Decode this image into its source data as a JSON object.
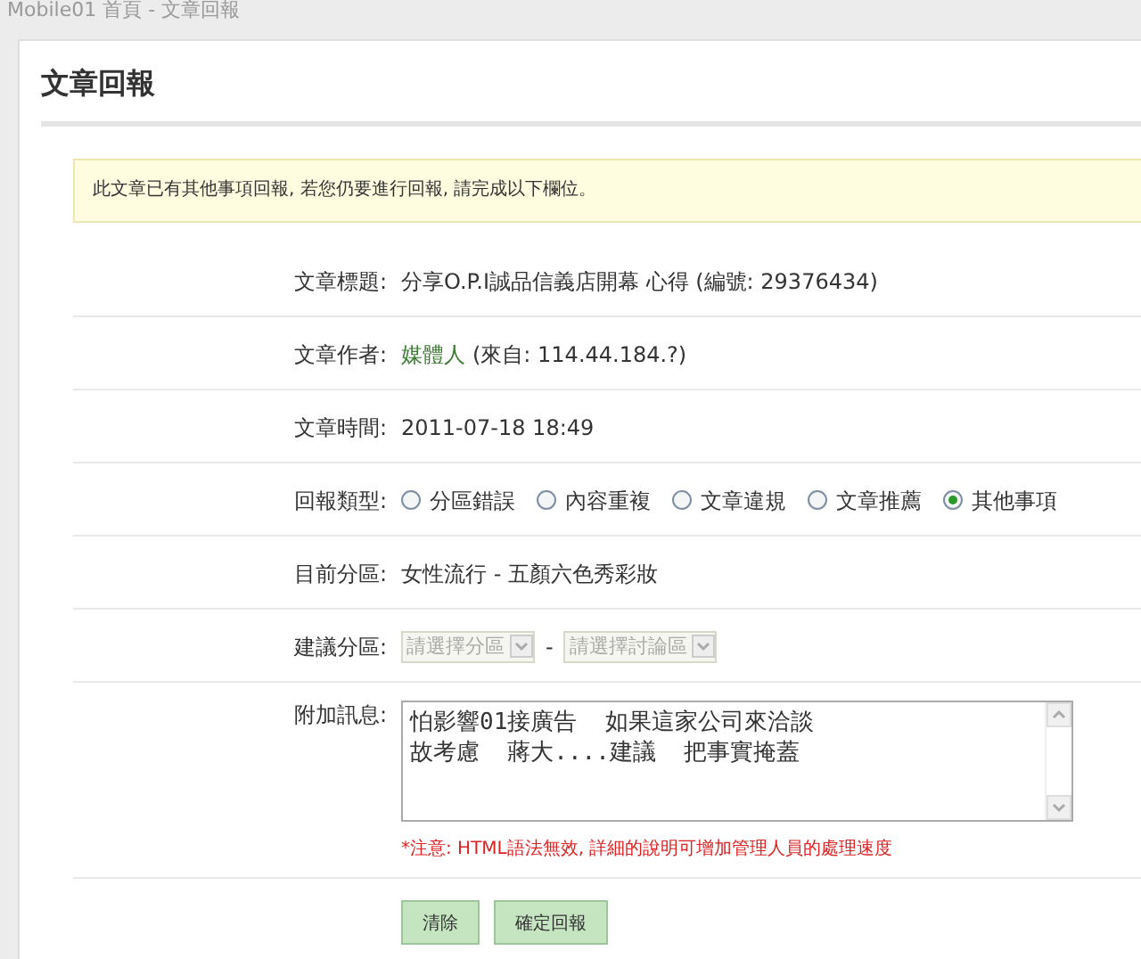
{
  "window": {
    "title": "Mobile01 首頁 - 文章回報"
  },
  "heading": "文章回報",
  "notice": "此文章已有其他事項回報, 若您仍要進行回報, 請完成以下欄位。",
  "fields": [
    {
      "kind": "text",
      "label": "文章標題:",
      "value": "分享O.P.I誠品信義店開幕 心得 (編號: 29376434)"
    },
    {
      "kind": "author",
      "label": "文章作者:",
      "link": "媒體人",
      "value": "(來自: 114.44.184.?)"
    },
    {
      "kind": "text",
      "label": "文章時間:",
      "value": "2011-07-18 18:49"
    },
    {
      "kind": "radios",
      "label": "回報類型:",
      "options": [
        {
          "label": "分區錯誤",
          "selected": false
        },
        {
          "label": "內容重複",
          "selected": false
        },
        {
          "label": "文章違規",
          "selected": false
        },
        {
          "label": "文章推薦",
          "selected": false
        },
        {
          "label": "其他事項",
          "selected": true
        }
      ]
    },
    {
      "kind": "text",
      "label": "目前分區:",
      "value": "女性流行 - 五顏六色秀彩妝"
    },
    {
      "kind": "selects",
      "label": "建議分區:",
      "selects": [
        {
          "placeholder": "請選擇分區",
          "disabled": true
        },
        {
          "placeholder": "請選擇討論區",
          "disabled": true
        }
      ],
      "separator": "-"
    },
    {
      "kind": "textarea",
      "label": "附加訊息:",
      "lines": [
        "怕影響01接廣告  如果這家公司來洽談",
        "故考慮  蔣大....建議  把事實掩蓋"
      ],
      "note": "*注意: HTML語法無效, 詳細的說明可增加管理人員的處理速度"
    }
  ],
  "buttons": [
    "清除",
    "確定回報"
  ]
}
